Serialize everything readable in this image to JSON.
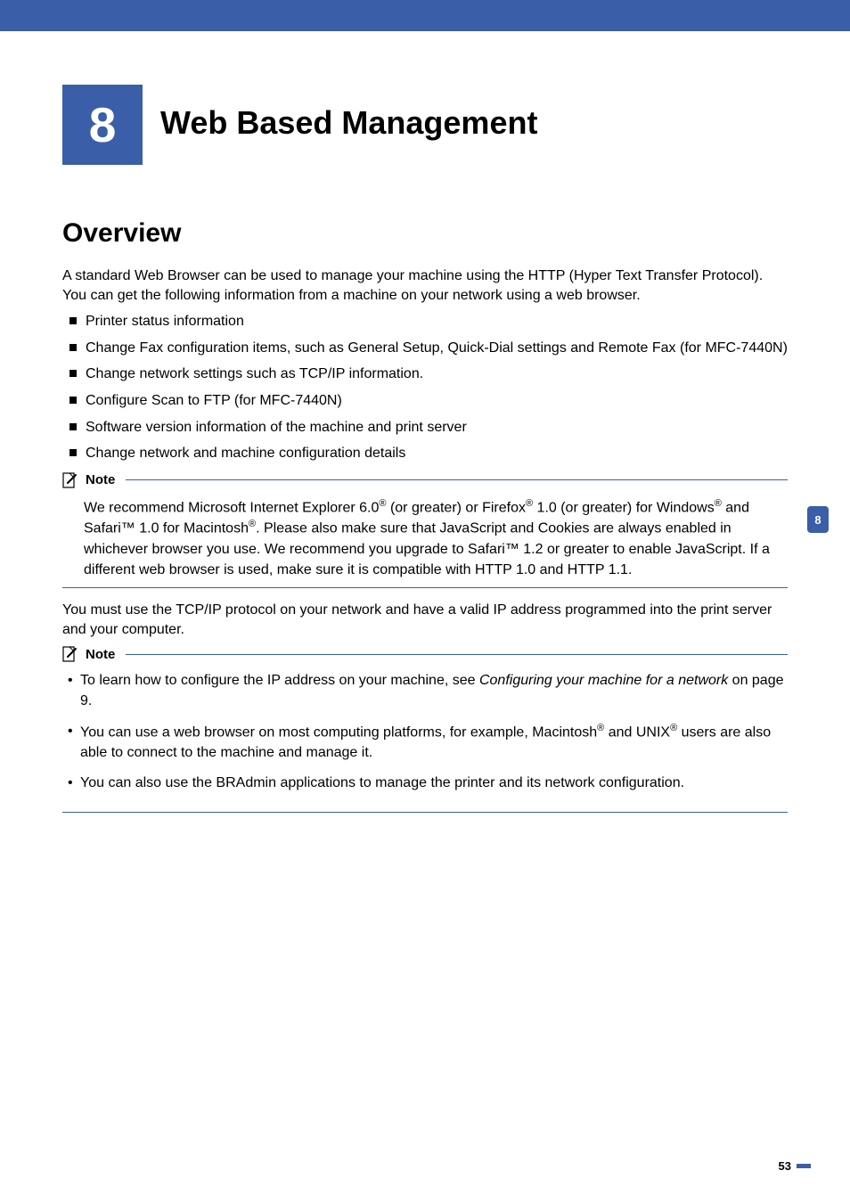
{
  "chapter": {
    "number": "8",
    "title": "Web Based Management"
  },
  "section": {
    "title": "Overview"
  },
  "intro": "A standard Web Browser can be used to manage your machine using the HTTP (Hyper Text Transfer Protocol). You can get the following information from a machine on your network using a web browser.",
  "bullets": [
    "Printer status information",
    "Change Fax configuration items, such as General Setup, Quick-Dial settings and Remote Fax (for MFC-7440N)",
    "Change network settings such as TCP/IP information.",
    "Configure Scan to FTP (for MFC-7440N)",
    "Software version information of the machine and print server",
    "Change network and machine configuration details"
  ],
  "note1": {
    "label": "Note",
    "p1a": "We recommend Microsoft Internet Explorer 6.0",
    "p1b": " (or greater) or Firefox",
    "p1c": " 1.0 (or greater) for Windows",
    "p1d": " and Safari™ 1.0 for Macintosh",
    "p1e": ". Please also make sure that JavaScript and Cookies are always enabled in whichever browser you use. We recommend you upgrade to Safari™ 1.2 or greater to enable JavaScript. If a different web browser is used, make sure it is compatible with HTTP 1.0 and HTTP 1.1."
  },
  "middle_para": "You must use the TCP/IP protocol on your network and have a valid IP address programmed into the print server and your computer.",
  "note2": {
    "label": "Note",
    "item1a": "To learn how to configure the IP address on your machine, see ",
    "item1b": "Configuring your machine for a network",
    "item1c": " on page 9.",
    "item2a": "You can use a web browser on most computing platforms, for example, Macintosh",
    "item2b": " and UNIX",
    "item2c": " users are also able to connect to the machine and manage it.",
    "item3": "You can also use the BRAdmin applications to manage the printer and its network configuration."
  },
  "side_tab": "8",
  "page_number": "53",
  "reg": "®"
}
